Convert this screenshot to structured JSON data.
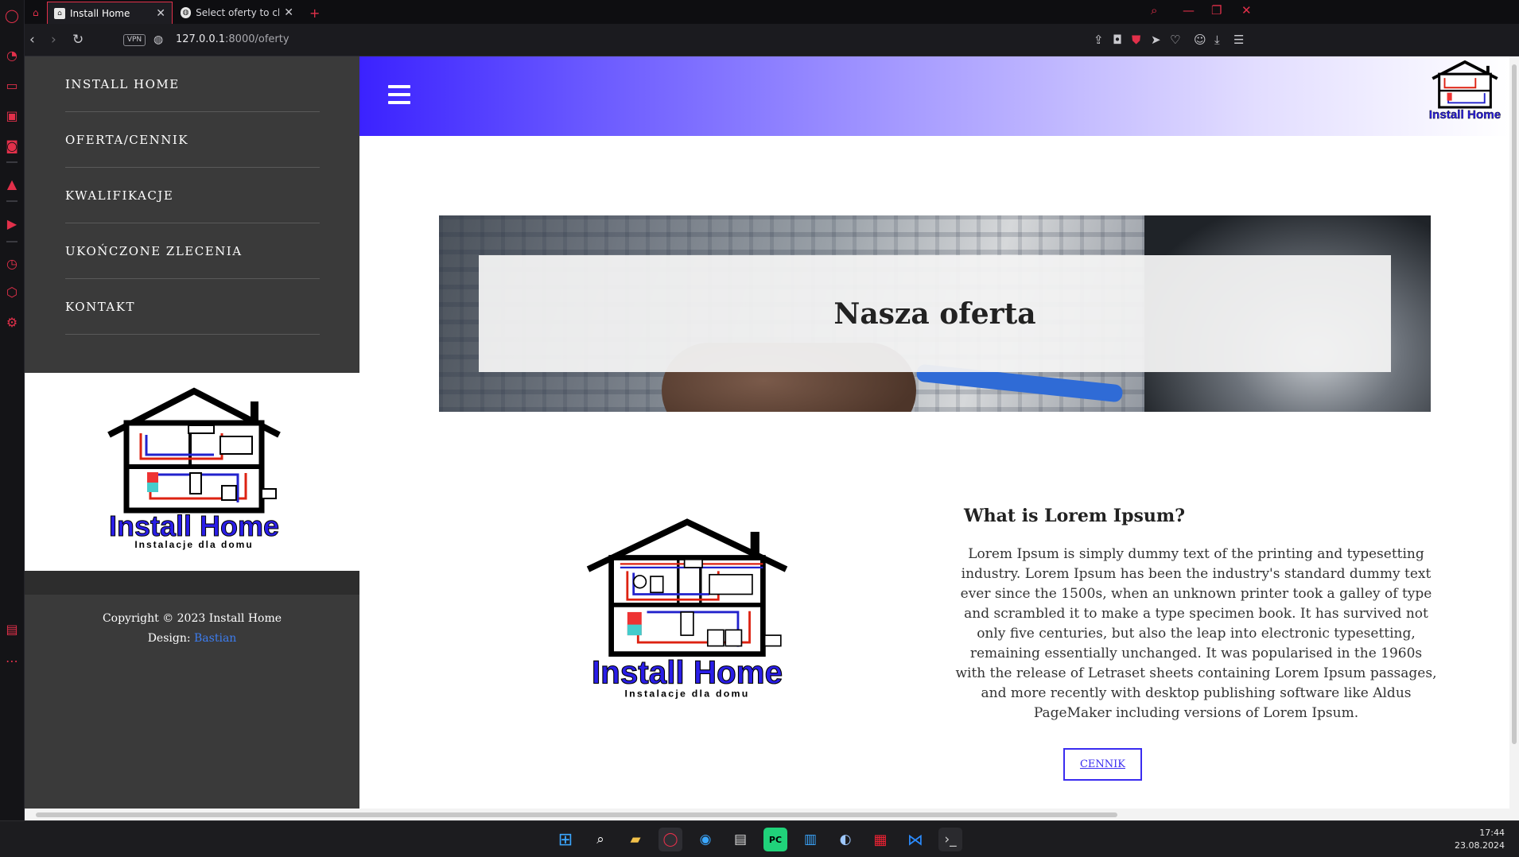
{
  "browser": {
    "tabs": [
      {
        "title": "Install Home"
      },
      {
        "title": "Select oferty to change | Dj"
      }
    ],
    "new_tab": "+",
    "url_host": "127.0.0.1",
    "url_path": ":8000/oferty",
    "vpn_label": "VPN"
  },
  "sidebar": {
    "menu": [
      {
        "label": "INSTALL HOME"
      },
      {
        "label": "OFERTA/CENNIK"
      },
      {
        "label": "KWALIFIKACJE"
      },
      {
        "label": "UKOŃCZONE ZLECENIA"
      },
      {
        "label": "KONTAKT"
      }
    ],
    "logo": {
      "brand": "Install Home",
      "tagline": "Instalacje dla domu"
    },
    "footer": {
      "copyright": "Copyright © 2023 Install Home",
      "design_label": "Design: ",
      "design_author": "Bastian"
    }
  },
  "header": {
    "logo_brand": "Install Home"
  },
  "hero": {
    "title": "Nasza oferta"
  },
  "about": {
    "logo_brand": "Install Home",
    "logo_tagline": "Instalacje dla domu",
    "title": "What is Lorem Ipsum?",
    "text": "Lorem Ipsum is simply dummy text of the printing and typesetting industry. Lorem Ipsum has been the industry's standard dummy text ever since the 1500s, when an unknown printer took a galley of type and scrambled it to make a type specimen book. It has survived not only five centuries, but also the leap into electronic typesetting, remaining essentially unchanged. It was popularised in the 1960s with the release of Letraset sheets containing Lorem Ipsum passages, and more recently with desktop publishing software like Aldus PageMaker including versions of Lorem Ipsum.",
    "button": "CENNIK"
  },
  "taskbar": {
    "time": "17:44",
    "date": "23.08.2024"
  },
  "colors": {
    "accent": "#3b22ff",
    "sidebar": "#3a3a3a",
    "opera_red": "#e2304a",
    "link": "#3d7df0"
  }
}
